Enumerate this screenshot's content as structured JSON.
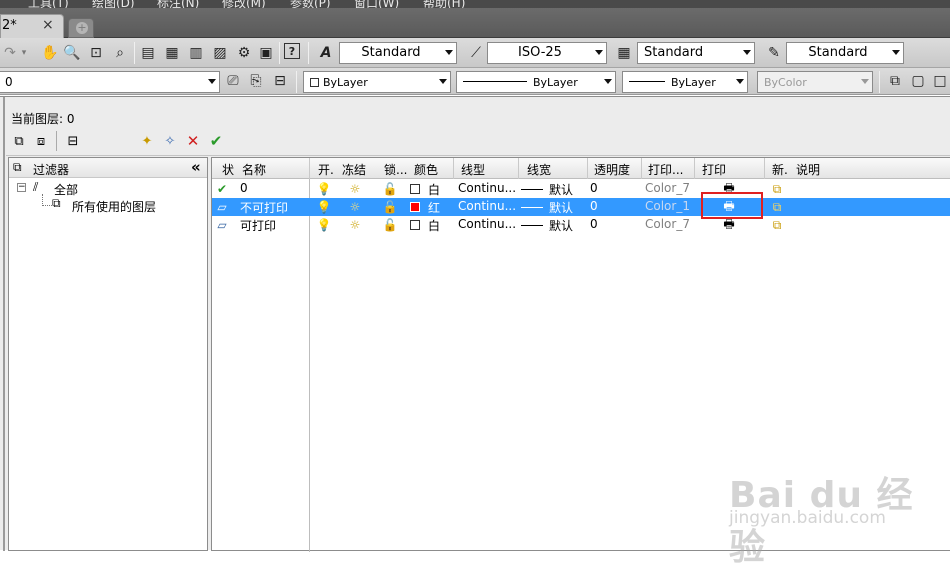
{
  "menu": {
    "items": [
      "工具(T)",
      "绘图(D)",
      "标注(N)",
      "修改(M)",
      "参数(P)",
      "窗口(W)",
      "帮助(H)"
    ]
  },
  "tabs": {
    "document": "2*",
    "close": "×",
    "new_tab": "+"
  },
  "toolbar1": {
    "text_style": "Standard",
    "dim_style": "ISO-25",
    "table_style": "Standard",
    "multileader_style": "Standard",
    "help_icon": "?"
  },
  "toolbar2": {
    "layer": "0",
    "color": "ByLayer",
    "linetype": "ByLayer",
    "lineweight": "ByLayer",
    "plot_style": "ByColor"
  },
  "dialog": {
    "current_layer_label": "当前图层: 0",
    "filter_header": "过滤器",
    "collapse": "«",
    "tree": {
      "all": "全部",
      "used": "所有使用的图层",
      "toggle": "−"
    },
    "columns": {
      "status": "状",
      "name": "名称",
      "on": "开.",
      "freeze": "冻结",
      "lock": "锁...",
      "color": "颜色",
      "linetype": "线型",
      "lineweight": "线宽",
      "transparency": "透明度",
      "plot_style": "打印...",
      "plot": "打印",
      "new_vp_freeze": "新.",
      "description": "说明"
    },
    "layers": [
      {
        "status": "current",
        "name": "0",
        "color_name": "白",
        "color_hex": "#ffffff",
        "linetype": "Continu...",
        "lineweight": "默认",
        "transparency": "0",
        "plot_style": "Color_7",
        "selected": false
      },
      {
        "status": "normal",
        "name": "不可打印",
        "color_name": "红",
        "color_hex": "#ff0000",
        "linetype": "Continu...",
        "lineweight": "默认",
        "transparency": "0",
        "plot_style": "Color_1",
        "selected": true
      },
      {
        "status": "normal",
        "name": "可打印",
        "color_name": "白",
        "color_hex": "#ffffff",
        "linetype": "Continu...",
        "lineweight": "默认",
        "transparency": "0",
        "plot_style": "Color_7",
        "selected": false
      }
    ]
  },
  "watermark": {
    "brand": "Bai du 经验",
    "site": "jingyan.baidu.com"
  },
  "colors": {
    "selection": "#3399ff",
    "highlight_box": "#e02020",
    "check": "#2a9a2a",
    "delete": "#d02020"
  },
  "icons": {
    "on": "lightbulb-icon",
    "freeze": "sun-icon",
    "lock": "unlock-icon",
    "plot": "printer-icon",
    "new_vp_freeze": "viewport-freeze-icon"
  }
}
